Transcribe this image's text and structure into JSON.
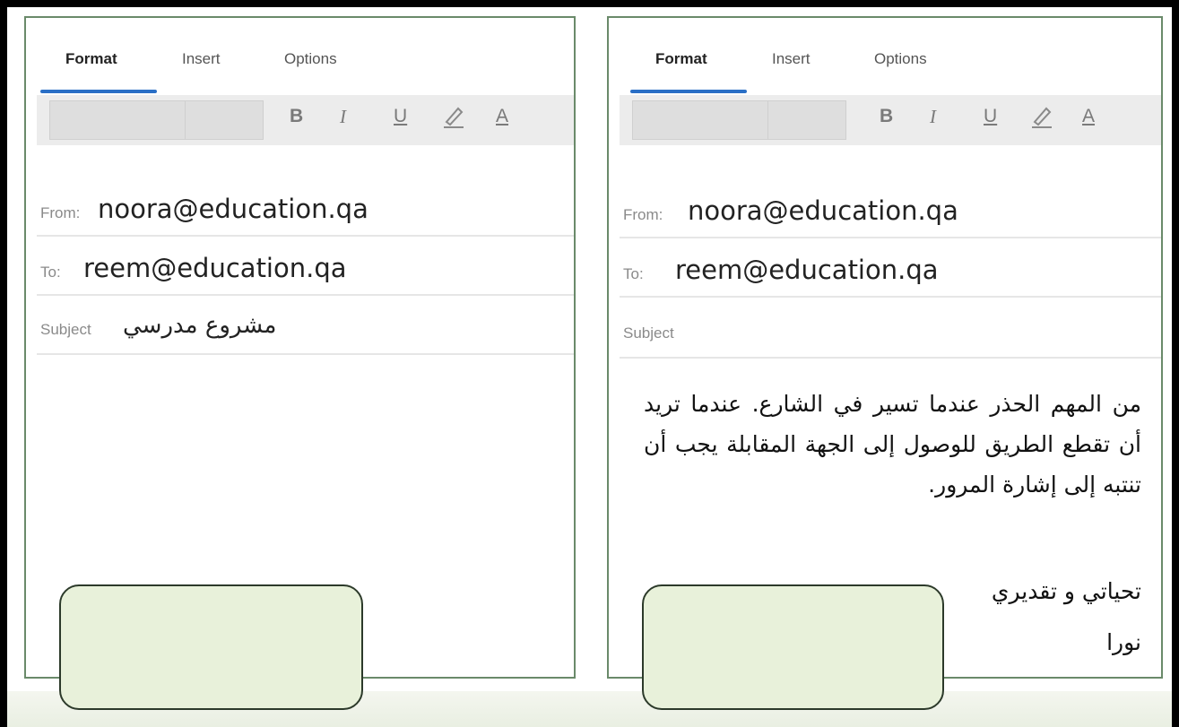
{
  "left_panel": {
    "tabs": [
      "Format",
      "Insert",
      "Options"
    ],
    "toolbar": {
      "bold": "B",
      "italic": "I",
      "underline": "U",
      "font_color": "A"
    },
    "from_label": "From:",
    "from_value": "noora@education.qa",
    "to_label": "To:",
    "to_value": "reem@education.qa",
    "subject_label": "Subject",
    "subject_value": "مشروع مدرسي"
  },
  "right_panel": {
    "tabs": [
      "Format",
      "Insert",
      "Options"
    ],
    "toolbar": {
      "bold": "B",
      "italic": "I",
      "underline": "U",
      "font_color": "A"
    },
    "from_label": "From:",
    "from_value": "noora@education.qa",
    "to_label": "To:",
    "to_value": "reem@education.qa",
    "subject_label": "Subject",
    "subject_value": "",
    "body": "من المهم الحذر عندما تسير في الشارع. عندما تريد أن تقطع الطريق للوصول إلى الجهة المقابلة يجب أن تنتبه إلى إشارة المرور.",
    "closing": "تحياتي و تقديري",
    "signature": "نورا"
  },
  "colors": {
    "frame": "#000000",
    "panel_border": "#6a8a6a",
    "tab_accent": "#2a6fc6",
    "answer_box_fill": "#e8f1da"
  },
  "icons": {
    "highlight": "pen-icon"
  }
}
